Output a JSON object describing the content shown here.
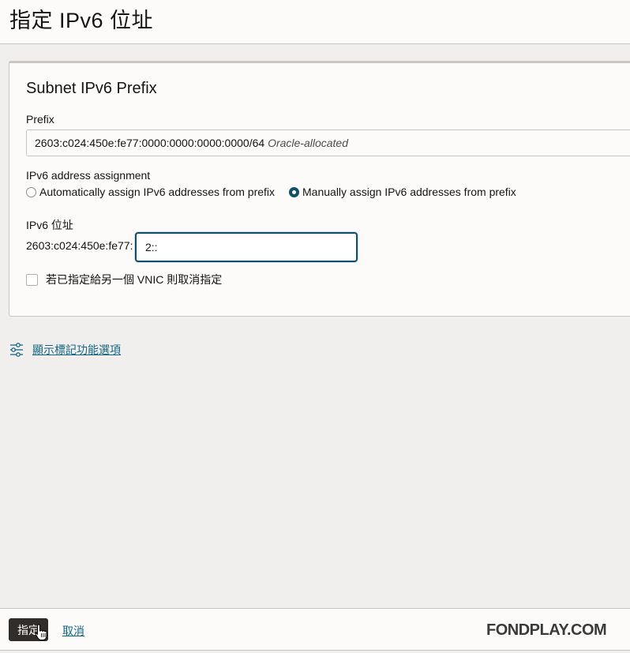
{
  "header": {
    "title": "指定 IPv6 位址"
  },
  "panel": {
    "title": "Subnet IPv6 Prefix",
    "prefix_label": "Prefix",
    "prefix_value": "2603:c024:450e:fe77:0000:0000:0000:0000/64",
    "prefix_note": "Oracle-allocated",
    "assignment_label": "IPv6 address assignment",
    "radio_auto_label": "Automatically assign IPv6 addresses from prefix",
    "radio_manual_label": "Manually assign IPv6 addresses from prefix",
    "selected_option": "manual",
    "ipv6_label": "IPv6 位址",
    "ipv6_prefix_text": "2603:c024:450e:fe77:",
    "ipv6_input_value": "2::",
    "unassign_label": "若已指定給另一個 VNIC 則取消指定",
    "unassign_checked": false
  },
  "tags_link": {
    "label": "顯示標記功能選項",
    "icon": "sliders-icon"
  },
  "footer": {
    "assign_label": "指定",
    "cancel_label": "取消"
  },
  "watermark": "FONDPLAY.COM",
  "colors": {
    "accent": "#104e6a",
    "link": "#156685",
    "button": "#312d2a"
  }
}
